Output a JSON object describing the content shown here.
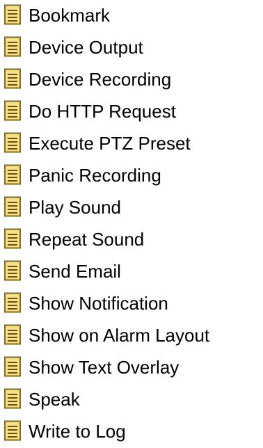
{
  "list": {
    "items": [
      {
        "label": "Bookmark",
        "icon": "document-icon"
      },
      {
        "label": "Device Output",
        "icon": "document-icon"
      },
      {
        "label": "Device Recording",
        "icon": "document-icon"
      },
      {
        "label": "Do HTTP Request",
        "icon": "document-icon"
      },
      {
        "label": "Execute PTZ Preset",
        "icon": "document-icon"
      },
      {
        "label": "Panic Recording",
        "icon": "document-icon"
      },
      {
        "label": "Play Sound",
        "icon": "document-icon"
      },
      {
        "label": "Repeat Sound",
        "icon": "document-icon"
      },
      {
        "label": "Send Email",
        "icon": "document-icon"
      },
      {
        "label": "Show Notification",
        "icon": "document-icon"
      },
      {
        "label": "Show on Alarm Layout",
        "icon": "document-icon"
      },
      {
        "label": "Show Text Overlay",
        "icon": "document-icon"
      },
      {
        "label": "Speak",
        "icon": "document-icon"
      },
      {
        "label": "Write to Log",
        "icon": "document-icon"
      }
    ]
  },
  "colors": {
    "icon_fill": "#f7e08a",
    "icon_border": "#8a6a18",
    "icon_lines": "#6b5315",
    "text": "#000000"
  }
}
